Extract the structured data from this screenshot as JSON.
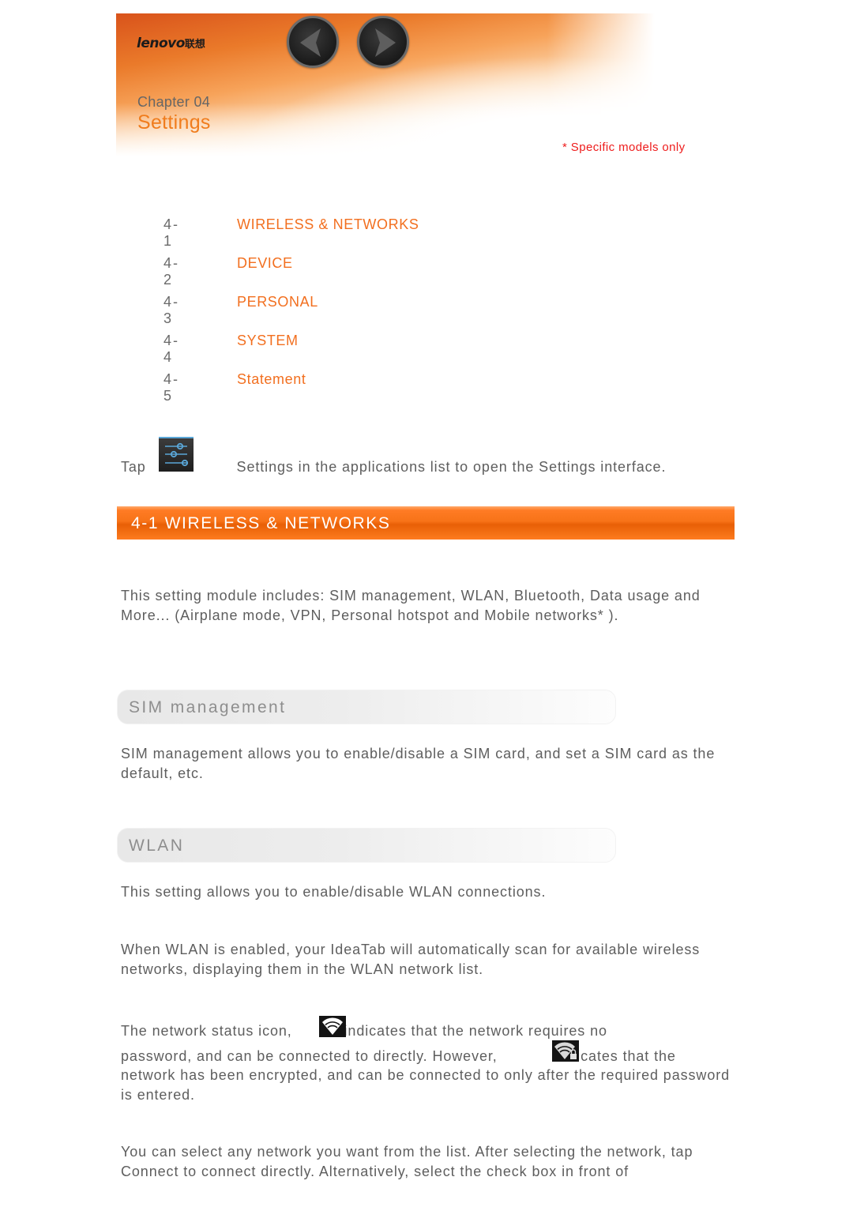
{
  "header": {
    "brand": "lenovo",
    "brand_cn": "联想",
    "nav": {
      "prev_icon": "chevron-left-icon",
      "next_icon": "chevron-right-icon"
    },
    "chapter_label": "Chapter 04",
    "chapter_title": "Settings",
    "note": "* Specific models only"
  },
  "colors": {
    "accent_orange": "#f26f1f",
    "note_red": "#ee1c1c",
    "body_text": "#5e5e5e",
    "section_bar": "#f77318"
  },
  "toc": [
    {
      "num": "4-1",
      "label": "WIRELESS & NETWORKS"
    },
    {
      "num": "4-2",
      "label": "DEVICE"
    },
    {
      "num": "4-3",
      "label": "PERSONAL"
    },
    {
      "num": "4-4",
      "label": "SYSTEM"
    },
    {
      "num": "4-5",
      "label": "Statement"
    }
  ],
  "intro": {
    "before_icon": "Tap",
    "after_icon": "Settings in the applications list to open the Settings interface.",
    "icon": "settings-app-icon"
  },
  "section": {
    "title": "4-1 WIRELESS & NETWORKS",
    "description": "This setting module includes: SIM management, WLAN, Bluetooth, Data usage and More... (Airplane mode, VPN, Personal hotspot and Mobile networks* )."
  },
  "subsections": [
    {
      "title": "SIM management",
      "paragraphs": [
        "SIM management allows you to enable/disable a SIM card, and set a SIM card as the default, etc."
      ]
    },
    {
      "title": "WLAN",
      "paragraphs": [
        "This setting allows you to enable/disable WLAN connections.",
        "When WLAN is enabled, your IdeaTab will automatically scan for available wireless networks, displaying them in the WLAN network list."
      ],
      "icon_para": {
        "part1": "The network status icon,",
        "part2": "indicates that the network requires no",
        "part3": "password, and can be connected to directly. However,",
        "part4": "indicates that the",
        "part5": "network has been encrypted, and can be connected to only after the required password is entered.",
        "open_icon": "wifi-open-icon",
        "locked_icon": "wifi-locked-icon"
      },
      "last_paragraph": "You can select any network you want from the list. After selecting the network, tap Connect to connect directly. Alternatively, select the check box in front of"
    }
  ]
}
